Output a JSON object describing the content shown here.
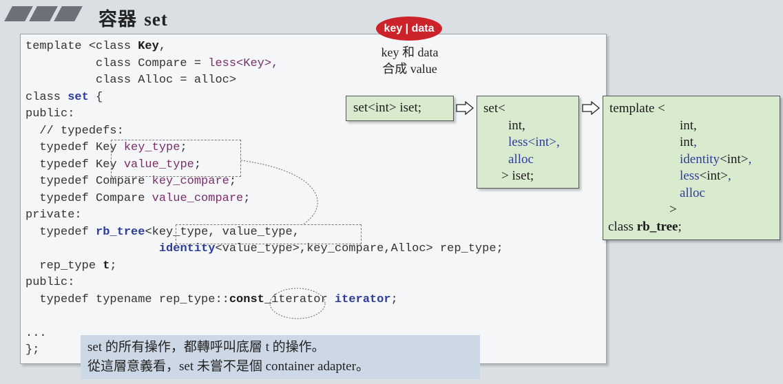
{
  "header": {
    "title_cjk": "容器",
    "title_word": "set"
  },
  "code": {
    "l1_a": "template <class ",
    "l1_b": "Key",
    "l1_c": ",",
    "l2_a": "          class Compare = ",
    "l2_b": "less<Key>,",
    "l3": "          class Alloc = alloc>",
    "l4_a": "class ",
    "l4_b": "set",
    "l4_c": " {",
    "l5": "public:",
    "l6": "  // typedefs:",
    "l7_a": "  typedef Key ",
    "l7_b": "key_type",
    "l7_c": ";",
    "l8_a": "  typedef Key ",
    "l8_b": "value_type",
    "l8_c": ";",
    "l9_a": "  typedef Compare ",
    "l9_b": "key_compare",
    "l9_c": ";",
    "l10_a": "  typedef Compare ",
    "l10_b": "value_compare",
    "l10_c": ";",
    "l11": "private:",
    "l12_a": "  typedef ",
    "l12_b": "rb_tree",
    "l12_c": "<key_type, value_type,",
    "l13_a": "                   ",
    "l13_b": "identity",
    "l13_c": "<value_type>,key_compare,Alloc> rep_type;",
    "l14_a": "  rep_type ",
    "l14_b": "t",
    "l14_c": ";",
    "l15": "public:",
    "l16_a": "  typedef typename rep_type::",
    "l16_b": "const_",
    "l16_c": "iterator ",
    "l16_d": "iterator",
    "l16_e": ";",
    "l17": "",
    "l18": "...",
    "l19": "};"
  },
  "badge": {
    "label": "key | data"
  },
  "badge_caption": {
    "line1": "key 和 data",
    "line2": "合成 value"
  },
  "box1": {
    "text": "set<int> iset;"
  },
  "box2": {
    "l1": "set<",
    "l2": "int,",
    "l3a": "less",
    "l3b": "<int>",
    "l3c": ",",
    "l4": "alloc",
    "l5": "> iset;"
  },
  "box3": {
    "l1": "template <",
    "l2": "int,",
    "l3a": "int",
    "l3b": ",",
    "l4a": "identity",
    "l4b": "<int>",
    "l4c": ",",
    "l5a": "less",
    "l5b": "<int>",
    "l5c": ",",
    "l6": "alloc",
    "l7": ">",
    "l8a": "class ",
    "l8b": "rb_tree",
    "l8c": ";"
  },
  "note": {
    "line1": "set 的所有操作，都轉呼叫底層 t 的操作。",
    "line2": "從這層意義看，set 未嘗不是個 container adapter。"
  },
  "colors": {
    "badge": "#cc2229",
    "green_box": "#d9ebce",
    "note_bg": "#cdd8e7",
    "code_purple": "#7a2f6a",
    "code_blue": "#2c3d9c"
  }
}
